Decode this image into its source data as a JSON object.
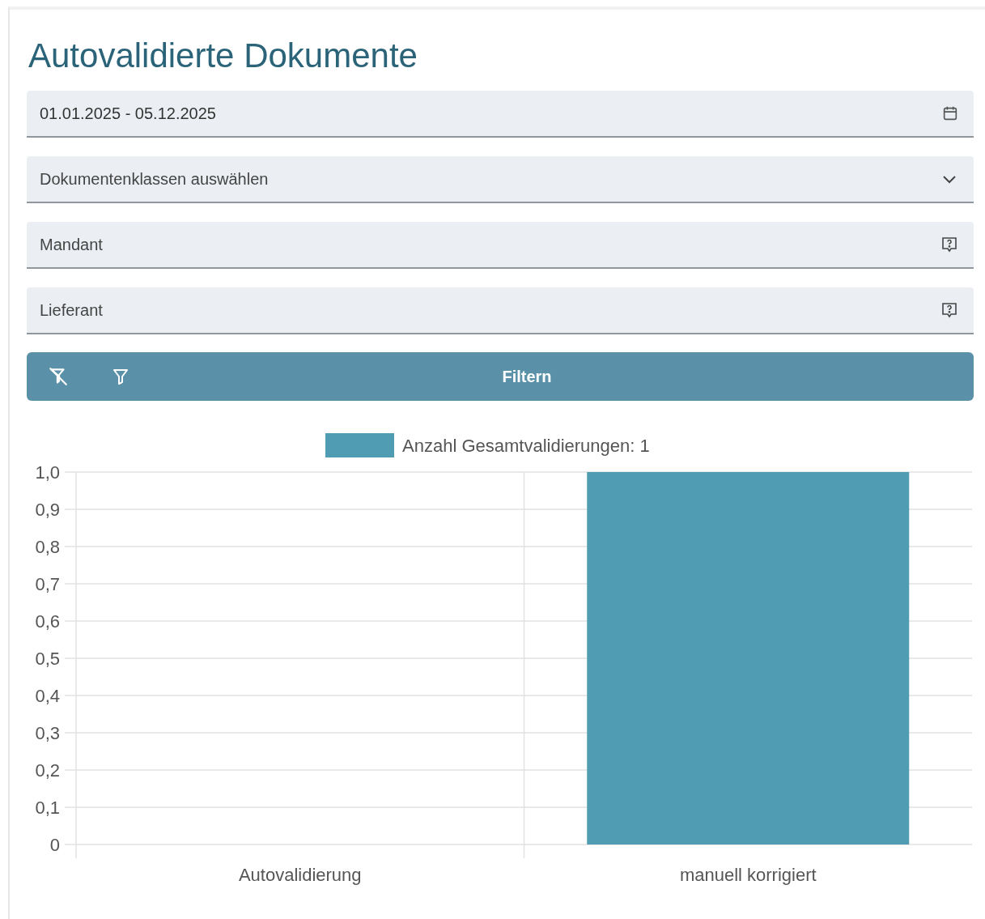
{
  "title": "Autovalidierte Dokumente",
  "filters": [
    {
      "kind": "date",
      "value": "01.01.2025 - 05.12.2025"
    },
    {
      "kind": "select",
      "placeholder": "Dokumentenklassen auswählen"
    },
    {
      "kind": "lookup",
      "placeholder": "Mandant"
    },
    {
      "kind": "lookup",
      "placeholder": "Lieferant"
    }
  ],
  "filter_bar": {
    "button": "Filtern"
  },
  "chart": {
    "chart_data": {
      "type": "bar",
      "categories": [
        "Autovalidierung",
        "manuell korrigiert"
      ],
      "series": [
        {
          "name": "Anzahl Gesamtvalidierungen: 1",
          "color": "#509cb2",
          "values": [
            0,
            1
          ]
        }
      ],
      "ylim": [
        0,
        1
      ],
      "grid": true,
      "yticks": [
        {
          "value": 0,
          "label": "0"
        },
        {
          "value": 0.1,
          "label": "0,1"
        },
        {
          "value": 0.2,
          "label": "0,2"
        },
        {
          "value": 0.3,
          "label": "0,3"
        },
        {
          "value": 0.4,
          "label": "0,4"
        },
        {
          "value": 0.5,
          "label": "0,5"
        },
        {
          "value": 0.6,
          "label": "0,6"
        },
        {
          "value": 0.7,
          "label": "0,7"
        },
        {
          "value": 0.8,
          "label": "0,8"
        },
        {
          "value": 0.9,
          "label": "0,9"
        },
        {
          "value": 1,
          "label": "1,0"
        }
      ]
    }
  }
}
